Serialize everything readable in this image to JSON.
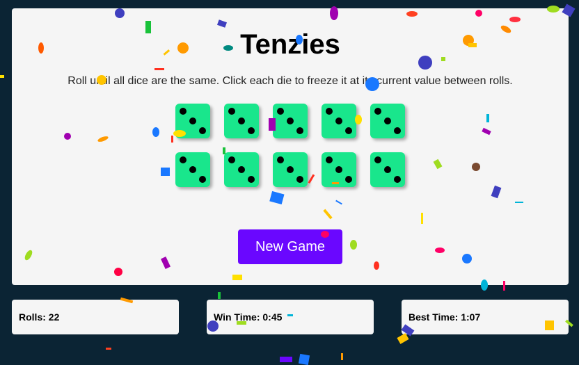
{
  "game": {
    "title": "Tenzies",
    "instructions": "Roll until all dice are the same. Click each die to freeze it at its current value between rolls.",
    "dice": [
      3,
      3,
      3,
      3,
      3,
      3,
      3,
      3,
      3,
      3
    ],
    "new_game_label": "New Game"
  },
  "stats": {
    "rolls": "Rolls: 22",
    "win_time": "Win Time: 0:45",
    "best_time": "Best Time: 1:07"
  },
  "colors": {
    "background": "#0b2434",
    "die": "#19e68c",
    "button": "#6a07ff"
  }
}
